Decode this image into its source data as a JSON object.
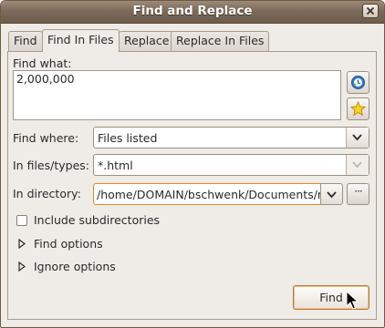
{
  "window": {
    "title": "Find and Replace"
  },
  "tabs": [
    {
      "label": "Find",
      "active": false
    },
    {
      "label": "Find In Files",
      "active": true
    },
    {
      "label": "Replace",
      "active": false
    },
    {
      "label": "Replace In Files",
      "active": false
    }
  ],
  "find_what": {
    "label": "Find what:",
    "value": "2,000,000"
  },
  "find_where": {
    "label": "Find where:",
    "value": "Files listed"
  },
  "file_types": {
    "label": "In files/types:",
    "value": "*.html",
    "enabled": false
  },
  "directory": {
    "label": "In directory:",
    "value": "/home/DOMAIN/bschwenk/Documents/m",
    "browse_label": "···"
  },
  "include_subdirs": {
    "label": "Include subdirectories",
    "checked": false
  },
  "find_options": {
    "label": "Find options",
    "expanded": false
  },
  "ignore_options": {
    "label": "Ignore options",
    "expanded": false
  },
  "find_button": {
    "label": "Find"
  },
  "colors": {
    "focus_border": "#e08a2c",
    "title_bar": "#7c6b5a"
  },
  "icons": [
    "close-icon",
    "history-icon",
    "star-icon",
    "chevron-down-icon",
    "triangle-right-icon",
    "mouse-cursor-icon"
  ]
}
